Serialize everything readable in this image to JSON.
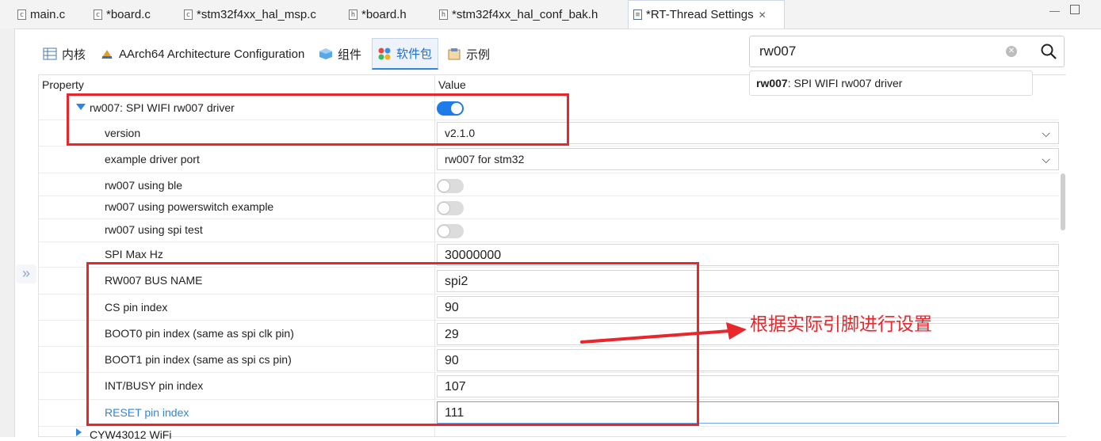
{
  "editor_tabs": [
    {
      "label": "main.c",
      "icon": "c"
    },
    {
      "label": "*board.c",
      "icon": "c"
    },
    {
      "label": "*stm32f4xx_hal_msp.c",
      "icon": "c"
    },
    {
      "label": "*board.h",
      "icon": "h"
    },
    {
      "label": "*stm32f4xx_hal_conf_bak.h",
      "icon": "h"
    },
    {
      "label": "*RT-Thread Settings",
      "icon": "settings",
      "active": true
    }
  ],
  "settings_tabs": [
    {
      "label": "内核",
      "icon": "table-icon"
    },
    {
      "label": "AArch64 Architecture Configuration",
      "icon": "chip-icon"
    },
    {
      "label": "组件",
      "icon": "cube-icon"
    },
    {
      "label": "软件包",
      "icon": "package-icon",
      "active": true
    },
    {
      "label": "示例",
      "icon": "example-icon"
    }
  ],
  "search": {
    "value": "rw007",
    "suggestion_bold": "rw007",
    "suggestion_rest": ": SPI WIFI rw007 driver"
  },
  "table": {
    "header_property": "Property",
    "header_value": "Value",
    "package_name": "rw007: SPI WIFI rw007 driver",
    "package_enabled": true,
    "rows": [
      {
        "label": "version",
        "value": "v2.1.0",
        "type": "dropdown"
      },
      {
        "label": "example driver port",
        "value": "rw007 for stm32",
        "type": "dropdown"
      },
      {
        "label": "rw007 using ble",
        "type": "toggle",
        "on": false
      },
      {
        "label": "rw007 using powerswitch example",
        "type": "toggle",
        "on": false
      },
      {
        "label": "rw007 using spi test",
        "type": "toggle",
        "on": false
      },
      {
        "label": "SPI Max Hz",
        "value": "30000000",
        "type": "text"
      },
      {
        "label": "RW007 BUS NAME",
        "value": "spi2",
        "type": "text"
      },
      {
        "label": "CS pin index",
        "value": "90",
        "type": "text"
      },
      {
        "label": "BOOT0 pin index (same as spi clk pin)",
        "value": "29",
        "type": "text"
      },
      {
        "label": "BOOT1 pin index (same as spi cs pin)",
        "value": "90",
        "type": "text"
      },
      {
        "label": "INT/BUSY pin index",
        "value": "107",
        "type": "text"
      },
      {
        "label": "RESET pin index",
        "value": "111",
        "type": "text",
        "selected": true
      }
    ],
    "next_package": "CYW43012 WiFi"
  },
  "annotation": {
    "text": "根据实际引脚进行设置",
    "color": "#e8262c"
  },
  "colors": {
    "accent": "#1e7ce8",
    "annotation_red": "#e8262c"
  }
}
